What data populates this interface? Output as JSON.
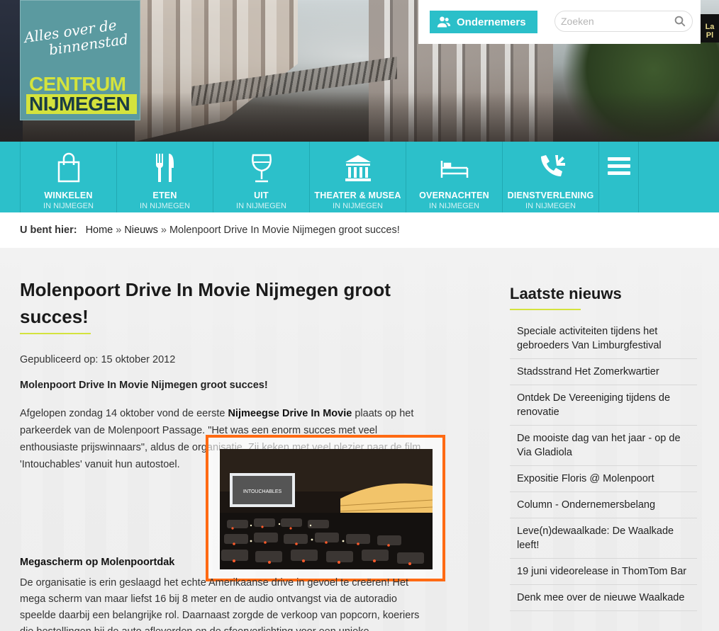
{
  "header": {
    "logo": {
      "tagline_line1": "Alles over de",
      "tagline_line2": "binnenstad",
      "name_line1": "CENTRUM",
      "name_line2": "NIJMEGEN"
    },
    "ondernemers_label": "Ondernemers",
    "search_placeholder": "Zoeken",
    "sign_text": "La Pl"
  },
  "nav": {
    "items": [
      {
        "label": "WINKELEN",
        "sub": "IN NIJMEGEN",
        "icon": "shopping-bag-icon"
      },
      {
        "label": "ETEN",
        "sub": "IN NIJMEGEN",
        "icon": "fork-knife-icon"
      },
      {
        "label": "UIT",
        "sub": "IN NIJMEGEN",
        "icon": "glass-icon"
      },
      {
        "label": "THEATER & MUSEA",
        "sub": "IN NIJMEGEN",
        "icon": "museum-icon"
      },
      {
        "label": "OVERNACHTEN",
        "sub": "IN NIJMEGEN",
        "icon": "bed-icon"
      },
      {
        "label": "DIENSTVERLENING",
        "sub": "IN NIJMEGEN",
        "icon": "phone-tools-icon"
      }
    ],
    "menu_icon": "hamburger-menu-icon"
  },
  "breadcrumb": {
    "label": "U bent hier:",
    "home": "Home",
    "sep": "»",
    "section": "Nieuws",
    "current": "Molenpoort Drive In Movie Nijmegen groot succes!"
  },
  "article": {
    "title": "Molenpoort Drive In Movie Nijmegen groot succes!",
    "published": "Gepubliceerd op: 15 oktober 2012",
    "lead": "Molenpoort Drive In Movie Nijmegen groot succes!",
    "para1_a": "Afgelopen zondag 14 oktober vond de eerste ",
    "para1_b": "Nijmeegse Drive In Movie",
    "para1_c": " plaats op het parkeerdek van de Molenpoort Passage. \"Het was een enorm succes met veel enthousiaste prijswinnaars\", aldus de organisatie. Zij keken met veel plezier naar de film 'Intouchables' vanuit hun autostoel.",
    "photo_screen_text": "INTOUCHABLES",
    "subheading": "Megascherm op Molenpoortdak",
    "para2": "De organisatie is erin geslaagd het echte Amerikaanse drive in gevoel te creëren! Het mega scherm van maar liefst 16 bij 8 meter en de audio ontvangst via de autoradio speelde daarbij een belangrijke rol. Daarnaast zorgde de verkoop van popcorn, koeriers die bestellingen bij de auto afleverden en de sfeerverlichting voor een unieke"
  },
  "sidebar": {
    "title": "Laatste nieuws",
    "items": [
      "Speciale activiteiten tijdens het gebroeders Van Limburgfestival",
      "Stadsstrand Het Zomerkwartier",
      "Ontdek De Vereeniging tijdens de renovatie",
      "De mooiste dag van het jaar - op de Via Gladiola",
      "Expositie Floris @ Molenpoort",
      "Column - Ondernemersbelang",
      "Leve(n)dewaalkade: De Waalkade leeft!",
      "19 juni videorelease in ThomTom Bar",
      "Denk mee over de nieuwe Waalkade"
    ]
  },
  "colors": {
    "teal": "#2cc0ca",
    "lime": "#d4e33d",
    "highlight_orange": "#ff6a13"
  }
}
